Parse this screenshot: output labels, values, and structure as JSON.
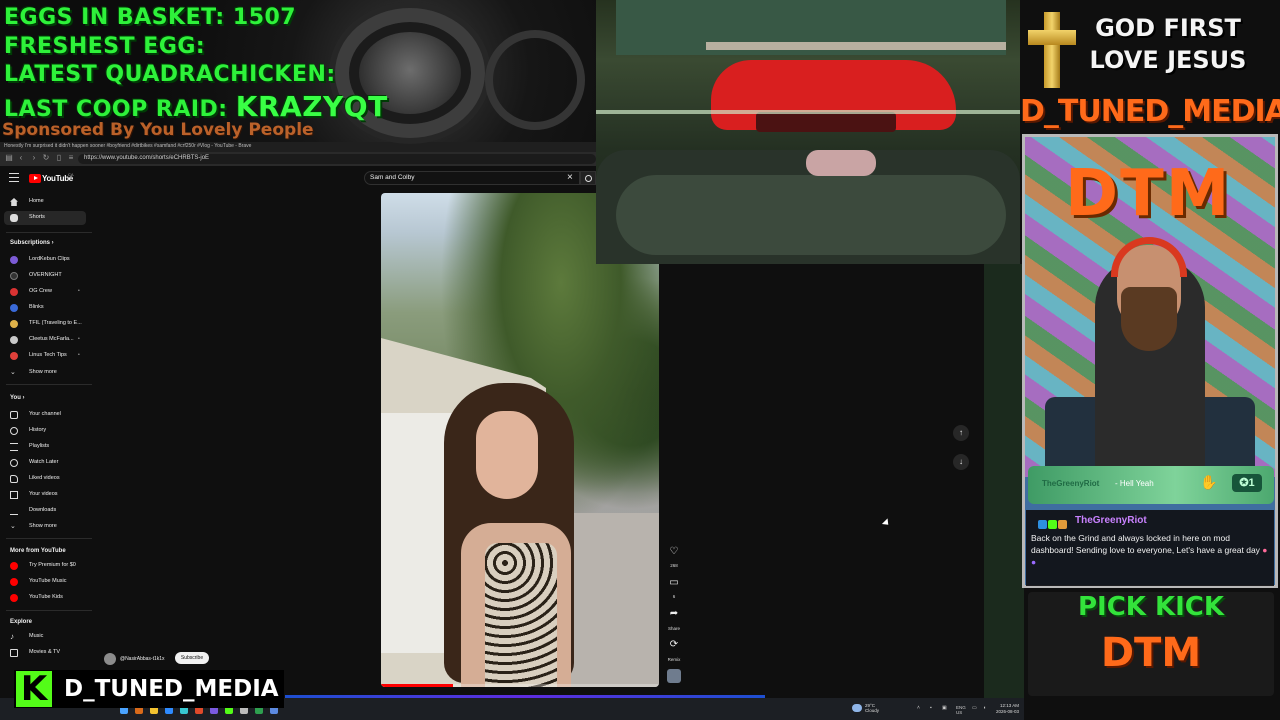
{
  "overlay": {
    "stats": {
      "eggs_label": "EGGS IN BASKET: 1507",
      "freshest_label": "FRESHEST EGG:",
      "quadrachicken_label": "LATEST QUADRACHICKEN:",
      "coop_raid_label": "LAST COOP RAID:",
      "coop_raid_name": "KRAZYQT"
    },
    "sponsor": "Sponsored By You Lovely People",
    "god_line1": "GOD FIRST",
    "god_line2": "LOVE JESUS",
    "brand_title": "D_TUNED_MEDIA",
    "webcam_sign": "DTM",
    "alert": {
      "user": "TheGreenyRiot",
      "message": "- Hell Yeah",
      "badge": "1"
    },
    "chat": {
      "user": "TheGreenyRiot",
      "message": "Back on the Grind and always locked in here on mod dashboard! Sending love to everyone, Let's have a great day"
    },
    "pick_kick": "PICK KICK",
    "kick_dtm": "DTM",
    "kick_badge_name": "D_TUNED_MEDIA",
    "kick_badge_logo": "K"
  },
  "browser": {
    "tab_title": "Honestly I'm surprised it didn't happen sooner #boyfriend #dirtbikes #samfand #crf250r #Vlog - YouTube - Brave",
    "url": "https://www.youtube.com/shorts/eCHRBTS-joE"
  },
  "youtube": {
    "logo": "YouTube",
    "region": "CA",
    "search": {
      "value": "Sam and Colby"
    },
    "sidebar": {
      "main": [
        {
          "label": "Home",
          "icon": "home-icon"
        },
        {
          "label": "Shorts",
          "icon": "shorts-icon"
        }
      ],
      "subscriptions_header": "Subscriptions",
      "subscriptions": [
        {
          "label": "LordKebun Clips",
          "color": "#7c5bd6"
        },
        {
          "label": "OVERNIGHT",
          "color": "#222222"
        },
        {
          "label": "OG Crew",
          "color": "#d93232"
        },
        {
          "label": "Blinks",
          "color": "#3a6ad8"
        },
        {
          "label": "TFIL (Traveling to E...",
          "color": "#e0b24a"
        },
        {
          "label": "Cleetus McFarla...",
          "color": "#c9c9c9"
        },
        {
          "label": "Linus Tech Tips",
          "color": "#e0403a"
        }
      ],
      "subs_show_more": "Show more",
      "you_header": "You",
      "you_items": [
        {
          "label": "Your channel",
          "icon": "channel-icon"
        },
        {
          "label": "History",
          "icon": "history-icon"
        },
        {
          "label": "Playlists",
          "icon": "playlist-icon"
        },
        {
          "label": "Watch Later",
          "icon": "clock-icon"
        },
        {
          "label": "Liked videos",
          "icon": "thumbs-up-icon"
        },
        {
          "label": "Your videos",
          "icon": "video-icon"
        },
        {
          "label": "Downloads",
          "icon": "download-icon"
        }
      ],
      "you_show_more": "Show more",
      "more_header": "More from YouTube",
      "more_items": [
        {
          "label": "Try Premium for $0",
          "color": "#ff0000"
        },
        {
          "label": "YouTube Music",
          "color": "#ff0000"
        },
        {
          "label": "YouTube Kids",
          "color": "#ff0000"
        }
      ],
      "explore_header": "Explore",
      "explore_items": [
        {
          "label": "Music",
          "icon": "music-icon"
        },
        {
          "label": "Movies & TV",
          "icon": "film-icon"
        }
      ]
    },
    "short": {
      "channel": "@NasirAbbas-t1k1x",
      "subscribe": "Subscribe",
      "progress": 0.26,
      "actions": {
        "like_count": "268",
        "comments_count": "6",
        "share_label": "Share",
        "remix_label": "Remix"
      }
    }
  },
  "taskbar": {
    "weather_temp": "29°C",
    "weather_desc": "Cloudy",
    "lang_line1": "ENG",
    "lang_line2": "US",
    "time": "12:13 AM",
    "date": "2026-08-03"
  },
  "colors": {
    "stats_green": "#2ef23a",
    "brand_orange": "#ff6a1a",
    "kick_green": "#53fc18",
    "youtube_red": "#ff0000"
  }
}
